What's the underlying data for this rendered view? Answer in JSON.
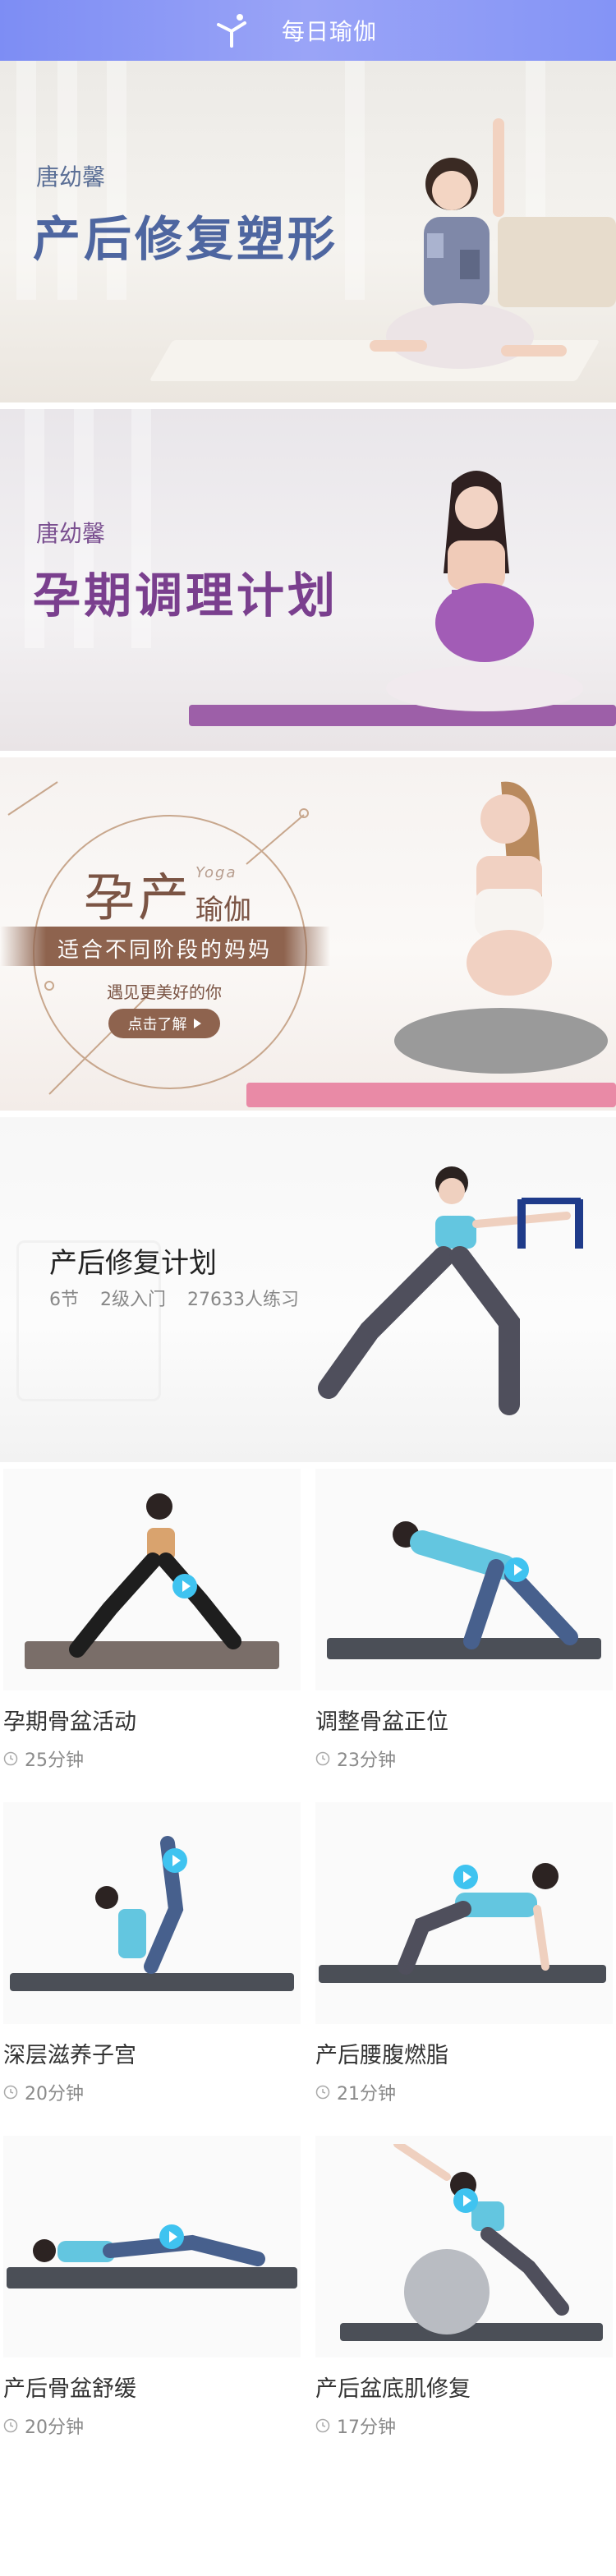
{
  "header": {
    "title": "每日瑜伽",
    "logo_icon": "yoga-pose-icon"
  },
  "banners": [
    {
      "subtitle": "唐幼馨",
      "headline": "产后修复塑形"
    },
    {
      "subtitle": "唐幼馨",
      "headline": "孕期调理计划"
    },
    {
      "big": "孕产",
      "yoga_en": "Yoga",
      "yoga_cn": "瑜伽",
      "ribbon": "适合不同阶段的妈妈",
      "tagline": "遇见更美好的你",
      "button": "点击了解"
    }
  ],
  "plan": {
    "title": "产后修复计划",
    "sessions": "6节",
    "level": "2级入门",
    "practitioners": "27633人练习"
  },
  "courses": [
    {
      "name": "孕期骨盆活动",
      "duration": "25分钟"
    },
    {
      "name": "调整骨盆正位",
      "duration": "23分钟"
    },
    {
      "name": "深层滋养子宫",
      "duration": "20分钟"
    },
    {
      "name": "产后腰腹燃脂",
      "duration": "21分钟"
    },
    {
      "name": "产后骨盆舒缓",
      "duration": "20分钟"
    },
    {
      "name": "产后盆底肌修复",
      "duration": "17分钟"
    }
  ],
  "colors": {
    "header": "#8494f6",
    "accent_blue": "#3fc3f0",
    "brown": "#8e634e",
    "purple": "#7a3f8e",
    "navy": "#4e66a0"
  }
}
